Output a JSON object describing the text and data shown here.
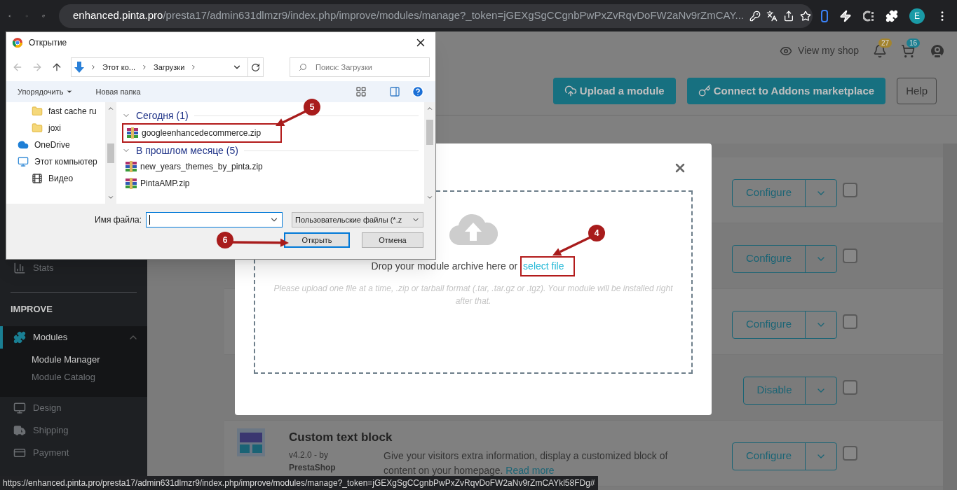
{
  "browser": {
    "host": "enhanced.pinta.pro",
    "path": "/presta17/admin631dlmzr9/index.php/improve/modules/manage?_token=jGEXgSgCCgnbPwPxZvRqvDoFW2aNv9rZmCAY...",
    "profile": "E"
  },
  "header": {
    "view_shop": "View my shop",
    "notifications": [
      {
        "count": "27",
        "color": "#a3842e"
      },
      {
        "count": "16",
        "color": "#1c7f91"
      }
    ]
  },
  "toolbar": {
    "buttons": [
      {
        "label": "Upload a module",
        "kind": "upload"
      },
      {
        "label": "Connect to Addons marketplace",
        "kind": "connect"
      },
      {
        "label": "Help",
        "kind": "outline"
      }
    ]
  },
  "sidebar": {
    "items": [
      {
        "kind": "item",
        "label": "Stats",
        "selected": false
      },
      {
        "kind": "section",
        "label": "IMPROVE"
      },
      {
        "kind": "item",
        "label": "Modules",
        "selected": true,
        "expanded": true,
        "children": [
          {
            "label": "Module Manager",
            "selected": true
          },
          {
            "label": "Module Catalog",
            "selected": false
          }
        ]
      },
      {
        "kind": "item",
        "label": "Design",
        "selected": false
      },
      {
        "kind": "item",
        "label": "Shipping",
        "selected": false
      },
      {
        "kind": "item",
        "label": "Payment",
        "selected": false
      }
    ]
  },
  "modules": [
    {
      "action": "Configure",
      "checked": false
    },
    {
      "action": "Configure",
      "checked": false
    },
    {
      "action": "Configure",
      "checked": false
    },
    {
      "action": "Disable",
      "checked": false
    },
    {
      "action": "Configure",
      "checked": false,
      "name": "Custom text block",
      "version": "v4.2.0 - by",
      "author": "PrestaShop",
      "description": "Give your visitors extra information, display a customized block of content on your homepage.",
      "link": "Read more"
    }
  ],
  "upload_modal": {
    "drop_text": "Drop your module archive here or",
    "link": "select file",
    "callout": "4",
    "hint": "Please upload one file at a time, .zip or tarball format (.tar, .tar.gz or .tgz). Your module will be installed right after that."
  },
  "file_dialog": {
    "title": "Открытие",
    "breadcrumb": [
      "Этот ко...",
      "Загрузки"
    ],
    "search_placeholder": "Поиск: Загрузки",
    "commands": [
      "Упорядочить",
      "Новая папка"
    ],
    "nav_items": [
      {
        "label": "fast cache ru",
        "kind": "folder"
      },
      {
        "label": "joxi",
        "kind": "folder"
      },
      {
        "label": "OneDrive",
        "kind": "cloud"
      },
      {
        "label": "Этот компьютер",
        "kind": "computer"
      },
      {
        "label": "Видео",
        "kind": "video"
      }
    ],
    "groups": [
      {
        "title": "Сегодня (1)",
        "expanded": true,
        "files": [
          {
            "name": "googleenhancedecommerce.zip",
            "selected": false,
            "callout": "5"
          }
        ]
      },
      {
        "title": "В прошлом месяце (5)",
        "expanded": true,
        "files": [
          {
            "name": "new_years_themes_by_pinta.zip",
            "selected": false
          },
          {
            "name": "PintaAMP.zip",
            "selected": false
          }
        ]
      }
    ],
    "filename_label": "Имя файла:",
    "filter": "Пользовательские файлы (*.z",
    "buttons": [
      {
        "label": "Открыть",
        "kind": "default",
        "callout": "6"
      },
      {
        "label": "Отмена",
        "kind": "normal"
      }
    ]
  },
  "status_bar": {
    "url": "https://enhanced.pinta.pro/presta17/admin631dlmzr9/index.php/improve/modules/manage?_token=jGEXgSgCCgnbPwPxZvRqvDoFW2aNv9rZmCAYkl58FDg#"
  }
}
